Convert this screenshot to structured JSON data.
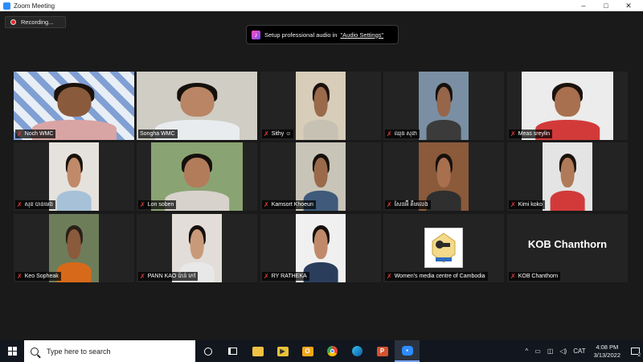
{
  "window": {
    "title": "Zoom Meeting",
    "controls": {
      "minimize": "–",
      "maximize": "□",
      "close": "✕"
    }
  },
  "recording": {
    "label": "Recording..."
  },
  "audio_banner": {
    "text": "Setup professional audio in",
    "link": "\"Audio Settings\""
  },
  "participants": [
    {
      "name": "Noch WMC"
    },
    {
      "name": "Songha WMC"
    },
    {
      "name": "Sithy ☺"
    },
    {
      "name": "ឈុន សុខា"
    },
    {
      "name": "Meas sreylin"
    },
    {
      "name": "សុខ បានមេង"
    },
    {
      "name": "Lon soben"
    },
    {
      "name": "Kamsort Khoeun"
    },
    {
      "name": "សែនអ៊ី គឹមលេង"
    },
    {
      "name": "Kimi koko"
    },
    {
      "name": "Keo Sopheak"
    },
    {
      "name": "PANN KAO ប៉ាន់ កៅ"
    },
    {
      "name": "RY RATHEKA"
    },
    {
      "name": "Women's media centre of Cambodia"
    },
    {
      "name": "KOB Chanthorn",
      "display_text": "KOB Chanthorn"
    }
  ],
  "taskbar": {
    "search_placeholder": "Type here to search",
    "apps": [
      "cortana-icon",
      "task-view-icon",
      "file-explorer-icon",
      "media-player-icon",
      "outlook-icon",
      "chrome-icon",
      "edge-icon",
      "powerpoint-icon",
      "zoom-icon"
    ],
    "tray": {
      "language": "CAT",
      "time": "4:08 PM",
      "date": "3/13/2022",
      "notifications": "2"
    }
  },
  "colors": {
    "accent": "#2d8cff",
    "active_speaker": "#c3e85c",
    "muted": "#e23a3a"
  }
}
